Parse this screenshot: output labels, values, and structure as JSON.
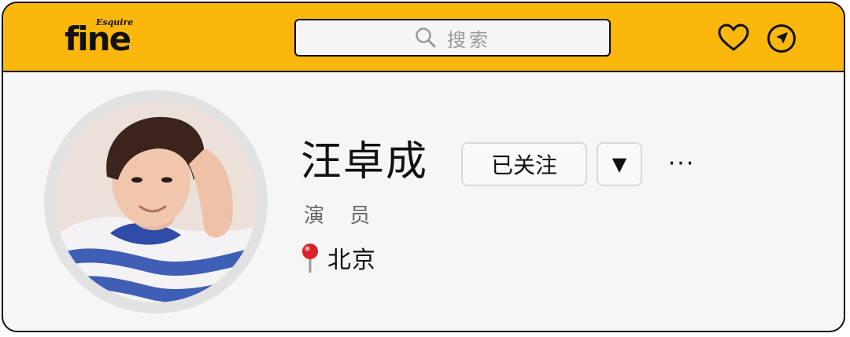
{
  "header": {
    "logo": {
      "brand": "fine",
      "sub_brand": "Esquire"
    },
    "search": {
      "placeholder": "搜索"
    },
    "icons": [
      "heart-icon",
      "compass-icon"
    ],
    "bar_color": "#fbb70c"
  },
  "profile": {
    "avatar_alt": "avatar",
    "name": "汪卓成",
    "follow_label": "已关注",
    "dropdown_label": "▼",
    "more_label": "···",
    "occupation": "演 员",
    "location": "北京",
    "location_icon": "pin-icon"
  }
}
